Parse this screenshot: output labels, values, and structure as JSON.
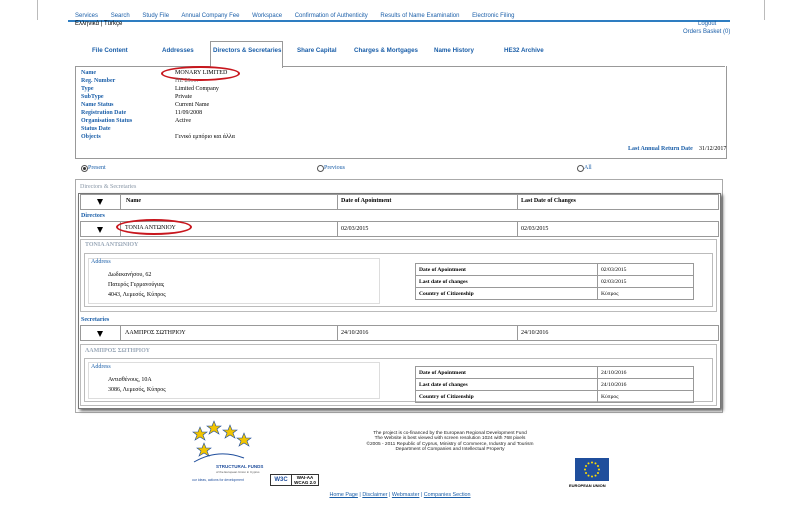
{
  "top_menu": [
    "Services",
    "Search",
    "Study File",
    "Annual Company Fee",
    "Workspace",
    "Confirmation of Authenticity",
    "Results of Name Examination",
    "Electronic Filing"
  ],
  "lang": {
    "greek": "Ελληνικά",
    "sep": " | ",
    "turkish": "Türkçe"
  },
  "logout": "Logout",
  "orders_basket": "Orders Basket (0)",
  "tabs": [
    "File Content",
    "Addresses",
    "Directors & Secretaries",
    "Share Capital",
    "Charges & Mortgages",
    "Name History",
    "HE32 Archive"
  ],
  "info": {
    "labels": [
      "Name",
      "Reg. Number",
      "Type",
      "SubType",
      "Name Status",
      "Registration Date",
      "Organisation Status",
      "Status Date",
      "Objects"
    ],
    "values": [
      "MONARY LIMITED",
      "HE 23.....",
      "Limited Company",
      "Private",
      "Current Name",
      "11/09/2008",
      "Active",
      "",
      "Γενικό εμπόριο και άλλα"
    ],
    "last_return_label": "Last Annual Return Date",
    "last_return_value": "31/12/2017"
  },
  "filter": {
    "present": "Present",
    "previous": "Previous",
    "all": "All",
    "selected": "Present"
  },
  "dir_section": {
    "title": "Directors & Secretaries",
    "col_name": "Name",
    "col_appoint": "Date of Apointment",
    "col_changes": "Last Date of Changes",
    "directors_label": "Directors",
    "secretaries_label": "Secretaries",
    "address_label": "Address",
    "detail_labels": [
      "Date of Apointment",
      "Last date of changes",
      "Country of Citizenship"
    ],
    "director": {
      "name": "ΤΟΝΙΑ ΑΝΤΩΝΙΟΥ",
      "appoint": "02/03/2015",
      "changes": "02/03/2015",
      "header": "ΤΟΝΙΑ ΑΝΤΩΝΙΟΥ",
      "addr": [
        "Δωδεκανήσου, 62",
        "Πατερός Γερμανούγιας",
        "4043, Λεμεσός, Κύπρος"
      ],
      "details": [
        "02/03/2015",
        "02/03/2015",
        "Κύπρος"
      ]
    },
    "secretary": {
      "name": "ΛΑΜΠΡΟΣ ΣΩΤΗΡΙΟΥ",
      "appoint": "24/10/2016",
      "changes": "24/10/2016",
      "header": "ΛΑΜΠΡΟΣ ΣΩΤΗΡΙΟΥ",
      "addr": [
        "Αντισθένους, 10Α",
        "3086, Λεμεσός, Κύπρος"
      ],
      "details": [
        "24/10/2016",
        "24/10/2016",
        "Κύπρος"
      ]
    }
  },
  "footer": {
    "lines": [
      "The project is co-financed by the European Regional Development Fund",
      "The Website is best viewed with screen resolution 1024 with 768 pixels",
      "©2005 - 2011 Republic of Cyprus, Ministry of Commerce, Industry and Tourism",
      "Department of Companies and Intellectual Property"
    ],
    "links": [
      "Home Page",
      "Disclaimer",
      "Webmaster",
      "Companies Section"
    ],
    "sf_title": "STRUCTURAL FUNDS",
    "sf_sub": "of the European Union in Cyprus",
    "sf_slogan": "our ideas, actions for development",
    "w3c": "W3C",
    "wai": "WAI-AA",
    "wcag": "WCAG 2.0",
    "eu": "EUROPEAN UNION"
  },
  "colors": {
    "accent": "#1a5ea8",
    "highlight_oval": "#c8161d",
    "eu_blue": "#1f4e9c",
    "eu_star": "#ffdd00"
  }
}
